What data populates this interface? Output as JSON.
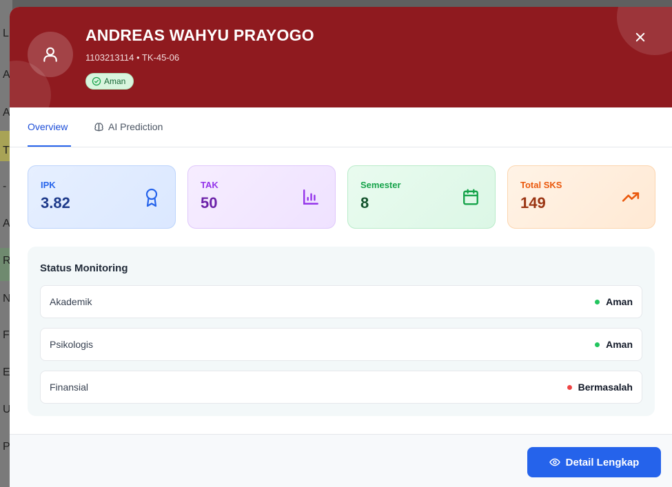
{
  "backdrop": {
    "letters": [
      "L",
      "A",
      "A",
      "T",
      "-",
      "A",
      "R",
      "N",
      "F",
      "E",
      "U",
      "P"
    ]
  },
  "student": {
    "name": "ANDREAS WAHYU PRAYOGO",
    "meta": "1103213114 • TK-45-06",
    "status_badge": "Aman",
    "avatar_icon": "user-icon"
  },
  "tabs": [
    {
      "label": "Overview",
      "active": true
    },
    {
      "label": "AI Prediction",
      "icon": "brain-icon",
      "active": false
    }
  ],
  "stats": [
    {
      "label": "IPK",
      "value": "3.82",
      "icon": "award-icon",
      "color": "#2563eb",
      "value_color": "#1e3a8a"
    },
    {
      "label": "TAK",
      "value": "50",
      "icon": "bar-chart-icon",
      "color": "#9333ea",
      "value_color": "#6b21a8"
    },
    {
      "label": "Semester",
      "value": "8",
      "icon": "calendar-icon",
      "color": "#16a34a",
      "value_color": "#14532d"
    },
    {
      "label": "Total SKS",
      "value": "149",
      "icon": "trending-up-icon",
      "color": "#ea580c",
      "value_color": "#9a3412"
    }
  ],
  "status_monitoring": {
    "title": "Status Monitoring",
    "rows": [
      {
        "label": "Akademik",
        "value": "Aman",
        "dot_color": "#22c55e"
      },
      {
        "label": "Psikologis",
        "value": "Aman",
        "dot_color": "#22c55e"
      },
      {
        "label": "Finansial",
        "value": "Bermasalah",
        "dot_color": "#ef4444"
      }
    ]
  },
  "footer": {
    "detail_label": "Detail Lengkap",
    "detail_icon": "eye-icon"
  },
  "colors": {
    "header": "#8f1a1f",
    "accent": "#2563eb"
  }
}
